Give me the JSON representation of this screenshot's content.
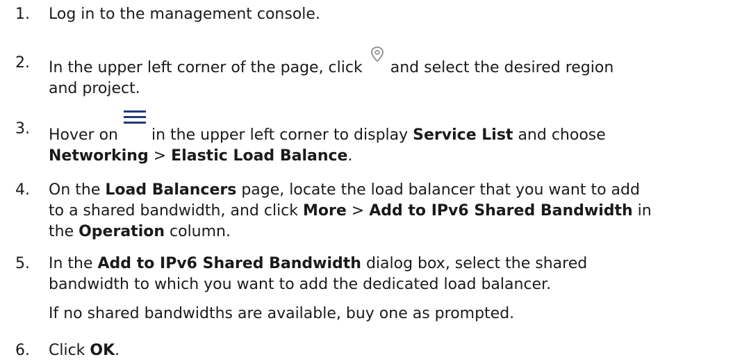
{
  "steps": [
    {
      "number": "1.",
      "text": "Log in to the management console."
    },
    {
      "number": "2.",
      "line1_pre": "In the upper left corner of the page, click",
      "line1_post": "and select the desired region",
      "line2": "and project.",
      "icon": "location-pin-icon"
    },
    {
      "number": "3.",
      "line1_pre": "Hover on",
      "line1_mid": "in the upper left corner to display",
      "line1_bold": "Service List",
      "line1_post": "and choose",
      "line2_bold1": "Networking",
      "line2_sep": ">",
      "line2_bold2": "Elastic Load Balance",
      "line2_end": ".",
      "icon": "hamburger-menu-icon"
    },
    {
      "number": "4.",
      "line1_pre": "On the",
      "line1_bold": "Load Balancers",
      "line1_post": "page, locate the load balancer that you want to add",
      "line2_pre": "to a shared bandwidth, and click",
      "line2_bold1": "More",
      "line2_sep": ">",
      "line2_bold2": "Add to IPv6 Shared Bandwidth",
      "line2_post": "in",
      "line3_pre": "the",
      "line3_bold": "Operation",
      "line3_post": "column."
    },
    {
      "number": "5.",
      "line1_pre": "In the",
      "line1_bold": "Add to IPv6 Shared Bandwidth",
      "line1_post": "dialog box, select the shared",
      "line2": "bandwidth to which you want to add the dedicated load balancer.",
      "note": "If no shared bandwidths are available, buy one as prompted."
    },
    {
      "number": "6.",
      "pre": "Click",
      "bold": "OK",
      "end": "."
    }
  ]
}
